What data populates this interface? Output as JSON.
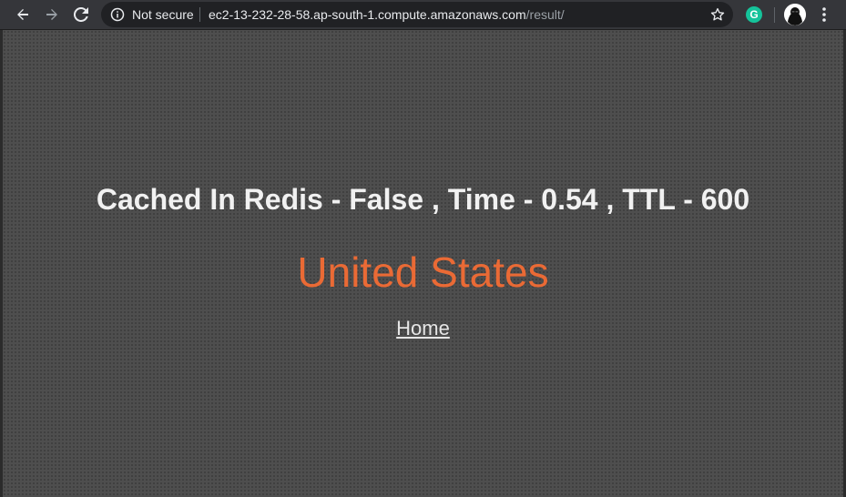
{
  "browser": {
    "security_label": "Not secure",
    "url_host": "ec2-13-232-28-58.ap-south-1.compute.amazonaws.com",
    "url_path": "/result/",
    "icons": {
      "back": "arrow-left",
      "forward": "arrow-right",
      "reload": "reload",
      "info": "info-circle",
      "bookmark": "star-outline",
      "extension": "grammarly",
      "profile": "avatar",
      "menu": "vertical-dots"
    }
  },
  "extension": {
    "grammarly_letter": "G",
    "color": "#15c39a"
  },
  "page": {
    "status_line": "Cached In Redis - False , Time - 0.54 , TTL - 600",
    "country": "United States",
    "home_link": "Home",
    "colors": {
      "background": "#4e4e4e",
      "heading": "#f1f1f1",
      "country": "#ea6a35",
      "link": "#e6e6e6"
    }
  }
}
